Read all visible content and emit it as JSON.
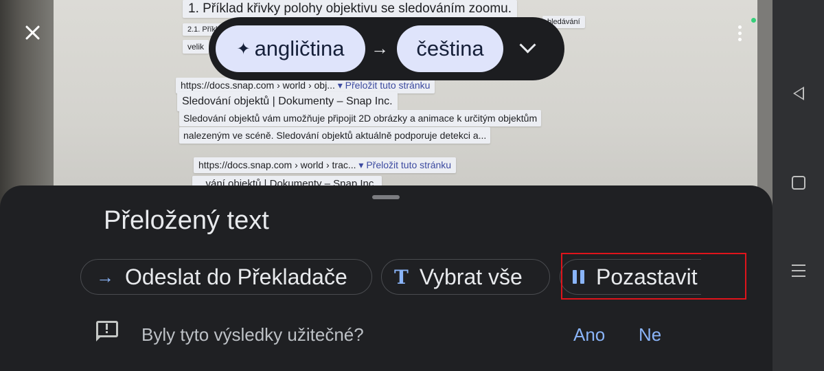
{
  "camera_text": {
    "heading": "1. Příklad křivky polohy objektivu se sledováním zoomu.",
    "line2_start": "2.1. Příkl",
    "line2_end": "bledávání",
    "line3_start": "velik",
    "result1": {
      "url": "https://docs.snap.com › world › obj...",
      "translate": "▾ Přeložit tuto stránku",
      "title": "Sledování objektů | Dokumenty – Snap Inc.",
      "snippet1": "Sledování objektů vám umožňuje připojit 2D obrázky a animace k určitým objektům",
      "snippet2": "nalezeným ve scéně. Sledování objektů aktuálně podporuje detekci a..."
    },
    "result2": {
      "url": "https://docs.snap.com › world › trac...",
      "translate": "▾ Přeložit tuto stránku",
      "title": "...vání objektů | Dokumenty – Snap Inc."
    }
  },
  "language_bar": {
    "source": "angličtina",
    "target": "čeština",
    "arrow": "→"
  },
  "sheet": {
    "title": "Přeložený text",
    "actions": {
      "send": "Odeslat do Překladače",
      "select_all": "Vybrat vše",
      "pause": "Pozastavit"
    },
    "feedback": {
      "question": "Byly tyto výsledky užitečné?",
      "yes": "Ano",
      "no": "Ne"
    }
  },
  "colors": {
    "accent": "#8ab4f8",
    "sheet_bg": "#1f2023",
    "lang_pill": "#dfe4fb",
    "highlight": "#e0141b",
    "status_dot": "#35d07a"
  },
  "icons": {
    "close": "close-icon",
    "more": "more-vert-icon",
    "sparkle": "sparkle-icon",
    "chevron": "chevron-down-icon",
    "send": "arrow-right-icon",
    "select": "text-icon",
    "pause": "pause-icon",
    "feedback": "feedback-icon",
    "nav_back": "back-icon",
    "nav_home": "home-icon",
    "nav_recents": "recents-icon"
  }
}
